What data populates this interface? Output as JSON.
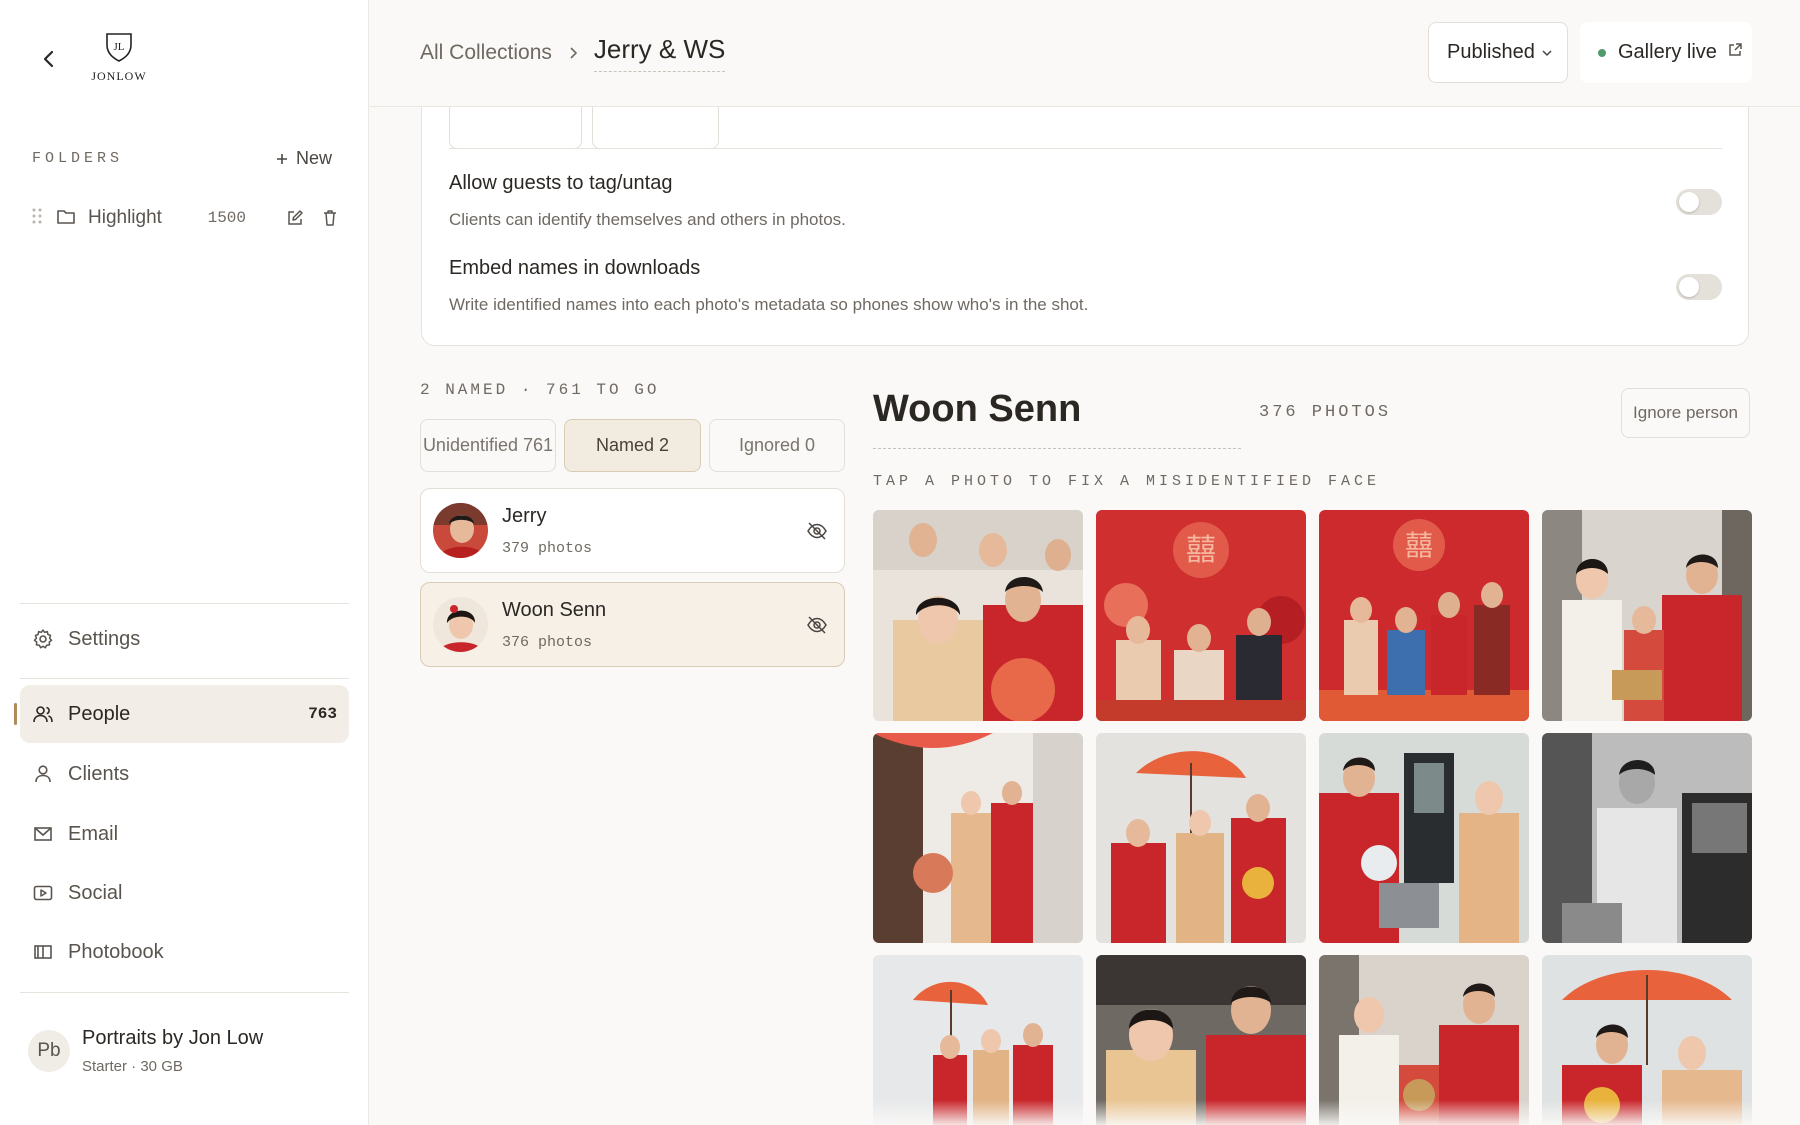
{
  "sidebar": {
    "logo_text": "JONLOW",
    "folders_title": "FOLDERS",
    "new_label": "New",
    "folders": [
      {
        "name": "Highlight",
        "count": "1500"
      }
    ],
    "nav": [
      {
        "label": "Settings"
      },
      {
        "label": "People",
        "badge": "763",
        "active": true
      },
      {
        "label": "Clients"
      },
      {
        "label": "Email"
      },
      {
        "label": "Social"
      },
      {
        "label": "Photobook"
      }
    ],
    "account": {
      "initials": "Pb",
      "name": "Portraits by Jon Low",
      "plan": "Starter · 30 GB"
    }
  },
  "header": {
    "breadcrumb_root": "All Collections",
    "collection_title": "Jerry & WS",
    "status": "Published",
    "gallery_live": "Gallery live",
    "live_color": "#4f9b6c"
  },
  "settings": {
    "options": [
      {
        "title": "Allow guests to tag/untag",
        "desc": "Clients can identify themselves and others in photos.",
        "enabled": false
      },
      {
        "title": "Embed names in downloads",
        "desc": "Write identified names into each photo's metadata so phones show who's in the shot.",
        "enabled": false
      }
    ]
  },
  "people": {
    "counts_label": "2 NAMED · 761 TO GO",
    "tabs": [
      {
        "label": "Unidentified 761"
      },
      {
        "label": "Named 2",
        "active": true
      },
      {
        "label": "Ignored 0"
      }
    ],
    "list": [
      {
        "name": "Jerry",
        "count": "379 photos"
      },
      {
        "name": "Woon Senn",
        "count": "376 photos",
        "selected": true
      }
    ]
  },
  "detail": {
    "name": "Woon Senn",
    "count": "376 PHOTOS",
    "ignore_label": "Ignore person",
    "hint": "TAP A PHOTO TO FIX A MISIDENTIFIED FACE",
    "photos": [
      "wedding-tea-ceremony-couple",
      "family-portrait-red-backdrop",
      "family-group-red-backdrop",
      "bride-gifting-baskets",
      "couple-entering-home",
      "couple-with-red-umbrella",
      "couple-at-car-door",
      "groom-at-car-bw",
      "procession-with-umbrella",
      "couple-closeup-ceremony",
      "guests-bringing-baskets",
      "couple-under-red-umbrella"
    ]
  },
  "colors": {
    "accent": "#b08a58",
    "ceremony_red": "#c8262b",
    "background": "#faf9f7"
  }
}
